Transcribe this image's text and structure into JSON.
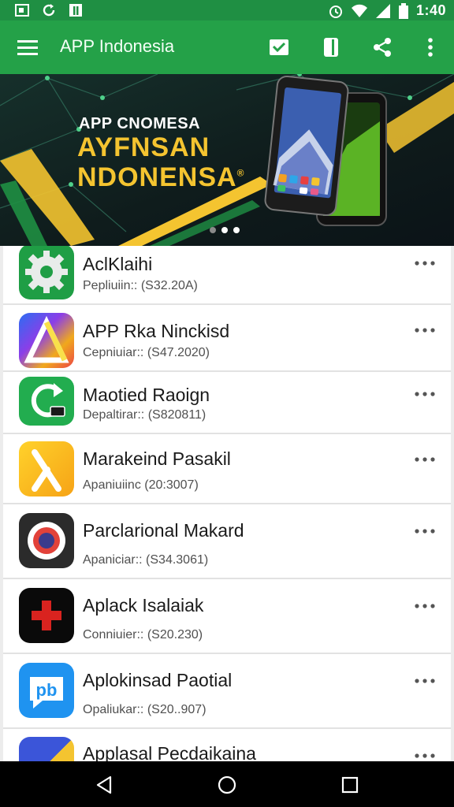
{
  "status_bar": {
    "time": "1:40",
    "left_icons": [
      "screenshot-icon",
      "sync-icon",
      "notification-icon"
    ],
    "right_icons": [
      "alarm-icon",
      "wifi-icon",
      "signal-icon",
      "battery-icon"
    ]
  },
  "app_bar": {
    "title": "APP Indonesia",
    "actions": [
      "check-box-icon",
      "phone-icon",
      "share-icon",
      "more-vert-icon"
    ],
    "color": "#24a148"
  },
  "banner": {
    "tagline": "APP CNOMESA",
    "headline_line1": "AYFNSAN",
    "headline_line2": "NDONENSA",
    "mark": "®",
    "dots_total": 3,
    "dot_active_index": 2,
    "accent_color": "#f4c430"
  },
  "apps": [
    {
      "name": "AclKlaihi",
      "subtitle": "Pepliuiin:: (S32.20A)",
      "icon": "gear-icon"
    },
    {
      "name": "APP Rka Ninckisd",
      "subtitle": "Cepniuiar:: (S47.2020)",
      "icon": "delta-logo-icon"
    },
    {
      "name": "Maotied Raoign",
      "subtitle": "Depaltirar:: (S820811)",
      "icon": "refresh-chat-icon"
    },
    {
      "name": "Marakeind Pasakil",
      "subtitle": "Apaniuiinc (20:3007)",
      "icon": "lambda-icon"
    },
    {
      "name": "Parclarional Makard",
      "subtitle": "Apaniciar:: (S34.3061)",
      "icon": "target-icon"
    },
    {
      "name": "Aplack Isalaiak",
      "subtitle": "Conniuier:: (S20.230)",
      "icon": "plus-cross-icon"
    },
    {
      "name": "Aplokinsad Paotial",
      "subtitle": "Opaliukar:: (S20..907)",
      "icon": "chat-bubble-icon"
    },
    {
      "name": "Applasal Pecdaikaina",
      "subtitle": "",
      "icon": "stripe-logo-icon"
    }
  ],
  "nav_bar": {
    "buttons": [
      "back-icon",
      "home-icon",
      "recents-icon"
    ]
  }
}
